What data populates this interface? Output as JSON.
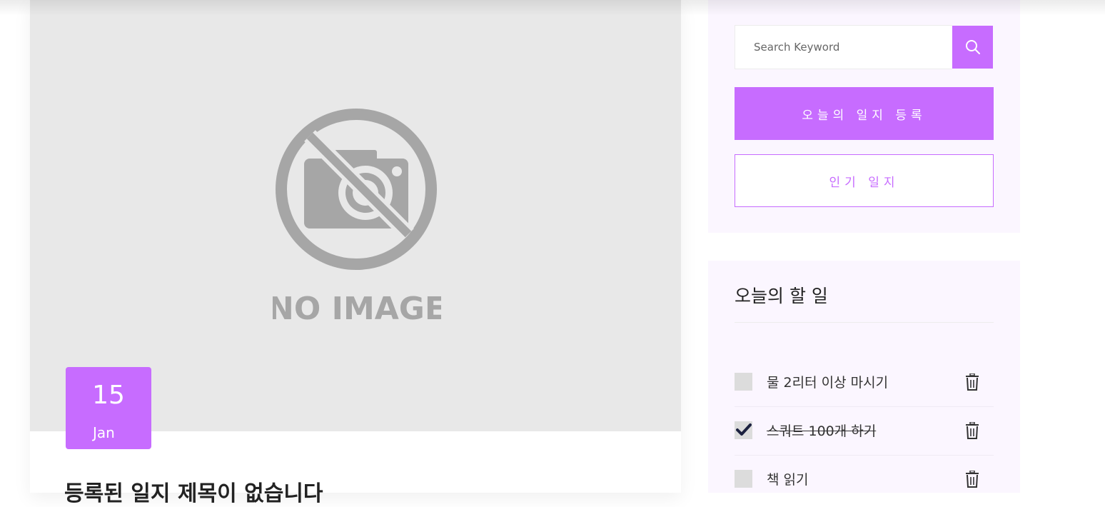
{
  "post": {
    "image_alt": "NO IMAGE",
    "date_day": "15",
    "date_month": "Jan",
    "title": "등록된 일지 제목이 없습니다"
  },
  "search": {
    "placeholder": "Search Keyword",
    "icon": "search-icon"
  },
  "buttons": {
    "register": "오늘의 일지 등록",
    "popular": "인기 일지"
  },
  "todo": {
    "title": "오늘의 할 일",
    "items": [
      {
        "label": "물 2리터 이상 마시기",
        "done": false
      },
      {
        "label": "스쿼트 100개 하기",
        "done": true
      },
      {
        "label": "책 읽기",
        "done": false
      }
    ]
  },
  "colors": {
    "accent": "#c76cff",
    "widget_bg": "#fbf6ff",
    "image_bg": "#e8e8e8"
  }
}
